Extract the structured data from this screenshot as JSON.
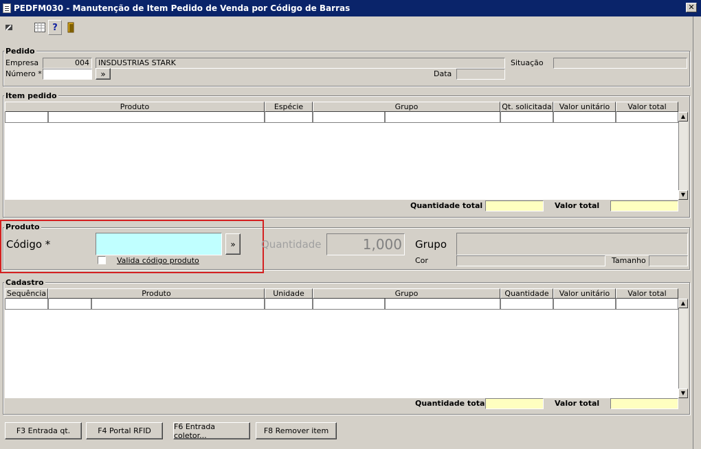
{
  "window": {
    "title": "PEDFM030 - Manutenção de Item Pedido de Venda por Código de Barras",
    "close_label": "✕"
  },
  "toolbar": {
    "icons": [
      "back-icon",
      "grid-icon",
      "help-icon",
      "exit-icon"
    ],
    "help_label": "?"
  },
  "pedido": {
    "title": "Pedido",
    "empresa_label": "Empresa",
    "empresa_code": "004",
    "empresa_name": "INSDUSTRIAS STARK",
    "situacao_label": "Situação",
    "situacao_value": "",
    "numero_label": "Número *",
    "numero_value": "",
    "numero_btn": "»",
    "data_label": "Data",
    "data_value": ""
  },
  "item_pedido": {
    "title": "Item pedido",
    "columns": [
      "Produto",
      "Espécie",
      "Grupo",
      "Qt. solicitada",
      "Valor unitário",
      "Valor total"
    ],
    "qtd_total_label": "Quantidade total",
    "valor_total_label": "Valor total",
    "qtd_total_value": "",
    "valor_total_value": ""
  },
  "produto": {
    "title": "Produto",
    "codigo_label": "Código *",
    "codigo_value": "",
    "codigo_btn": "»",
    "valida_label": "Valida código produto",
    "valida_checked": false,
    "quantidade_label": "Quantidade",
    "quantidade_value": "1,000",
    "grupo_label": "Grupo",
    "grupo_value": "",
    "cor_label": "Cor",
    "cor_value": "",
    "tamanho_label": "Tamanho",
    "tamanho_value": ""
  },
  "cadastro": {
    "title": "Cadastro",
    "columns": [
      "Sequência",
      "Produto",
      "Unidade",
      "Grupo",
      "Quantidade",
      "Valor unitário",
      "Valor total"
    ],
    "qtd_total_label": "Quantidade total",
    "valor_total_label": "Valor total",
    "qtd_total_value": "",
    "valor_total_value": ""
  },
  "buttons": {
    "f3": "F3 Entrada qt.",
    "f4": "F4 Portal RFID",
    "f6": "F6 Entrada coletor...",
    "f8": "F8 Remover item"
  },
  "scroll": {
    "up": "▲",
    "down": "▼"
  },
  "colors": {
    "titlebar": "#0a246a",
    "face": "#d4d0c8",
    "highlight_border": "#d42020",
    "total_field": "#ffffc0",
    "active_field": "#c0ffff"
  }
}
